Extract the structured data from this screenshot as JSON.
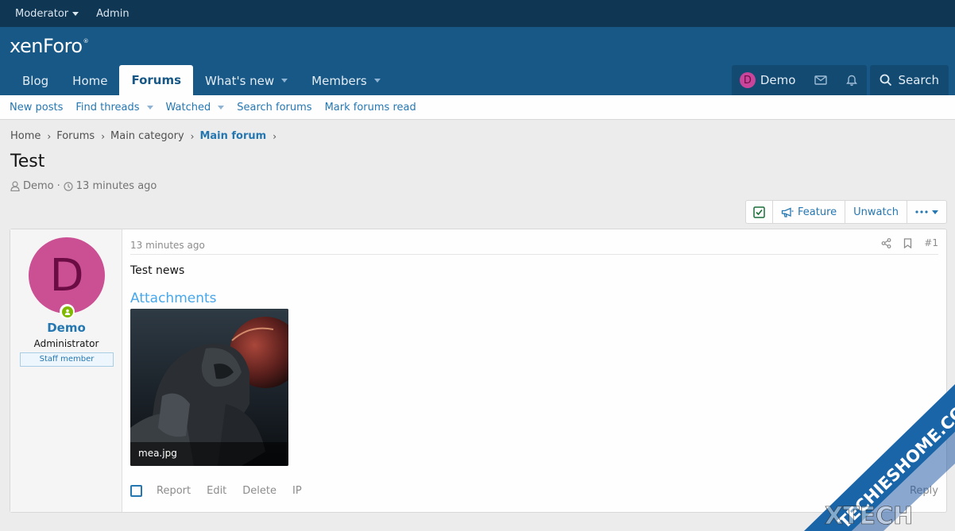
{
  "staff_bar": {
    "moderator": "Moderator",
    "admin": "Admin"
  },
  "header": {
    "logo": "xenForo",
    "logo_mark": "®"
  },
  "nav": {
    "tabs": [
      {
        "label": "Blog"
      },
      {
        "label": "Home"
      },
      {
        "label": "Forums",
        "active": true
      },
      {
        "label": "What's new"
      },
      {
        "label": "Members"
      }
    ],
    "account": {
      "initial": "D",
      "name": "Demo"
    },
    "search": "Search"
  },
  "subnav": {
    "items": [
      "New posts",
      "Find threads",
      "Watched",
      "Search forums",
      "Mark forums read"
    ]
  },
  "breadcrumb": [
    "Home",
    "Forums",
    "Main category",
    "Main forum"
  ],
  "thread": {
    "title": "Test",
    "author": "Demo",
    "time": "13 minutes ago",
    "actions": {
      "feature": "Feature",
      "unwatch": "Unwatch"
    }
  },
  "post": {
    "user": {
      "initial": "D",
      "name": "Demo",
      "title": "Administrator",
      "banner": "Staff member"
    },
    "date": "13 minutes ago",
    "number": "#1",
    "body": "Test news",
    "attachments_label": "Attachments",
    "attachment": {
      "filename": "mea.jpg"
    },
    "footer": {
      "report": "Report",
      "edit": "Edit",
      "delete": "Delete",
      "ip": "IP",
      "reply": "Reply"
    }
  },
  "watermark": {
    "line1": "TECHIESHOME.COM",
    "line2": "XTECH"
  },
  "colors": {
    "staff_bar": "#0f3652",
    "header": "#185886",
    "link": "#2577b1",
    "avatar": "#cb4f93",
    "online": "#7fb900"
  }
}
